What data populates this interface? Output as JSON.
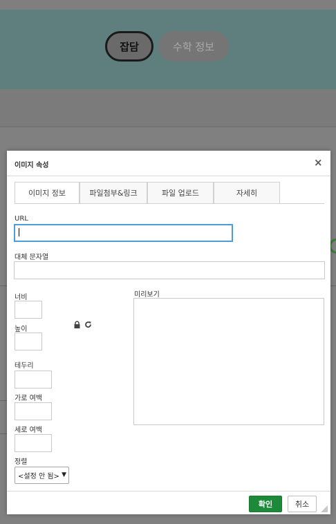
{
  "background": {
    "active_tab": "잡담",
    "inactive_tab": "수학 정보"
  },
  "dialog": {
    "title": "이미지 속성",
    "close_glyph": "×",
    "tabs": [
      {
        "label": "이미지 정보",
        "active": true
      },
      {
        "label": "파일첨부&링크",
        "active": false
      },
      {
        "label": "파일 업로드",
        "active": false
      },
      {
        "label": "자세히",
        "active": false
      }
    ],
    "url": {
      "label": "URL",
      "value": ""
    },
    "alt_text": {
      "label": "대체 문자열",
      "value": ""
    },
    "width": {
      "label": "너비",
      "value": ""
    },
    "height": {
      "label": "높이",
      "value": ""
    },
    "border": {
      "label": "테두리",
      "value": ""
    },
    "hspace": {
      "label": "가로 여백",
      "value": ""
    },
    "vspace": {
      "label": "세로 여백",
      "value": ""
    },
    "align": {
      "label": "정렬",
      "selected": "<설정 안 됨>"
    },
    "preview_label": "미리보기",
    "ok_button": "확인",
    "cancel_button": "취소"
  }
}
